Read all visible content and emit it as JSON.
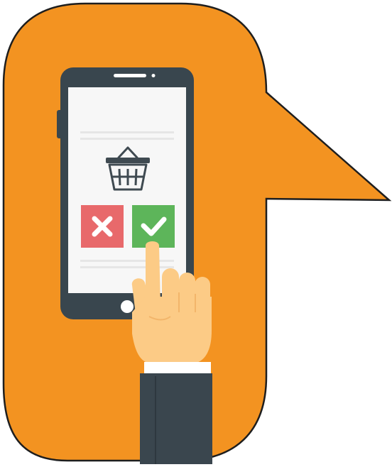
{
  "illustration": {
    "subject": "hand-tapping-approve-on-phone",
    "icons": [
      "shopping-basket-icon",
      "reject-x-icon",
      "approve-check-icon"
    ],
    "colors": {
      "bubble": "#F39321",
      "bubble_outline": "#1E1E1E",
      "phone_body": "#39464E",
      "phone_screen": "#F7F7F7",
      "screen_lines": "#E6E6E6",
      "basket": "#3F4A51",
      "reject": "#E8696B",
      "approve": "#5DB55A",
      "skin": "#FCCB86",
      "skin_shadow": "#F2B56A",
      "cuff": "#FFFFFF",
      "sleeve": "#3A464E"
    }
  }
}
